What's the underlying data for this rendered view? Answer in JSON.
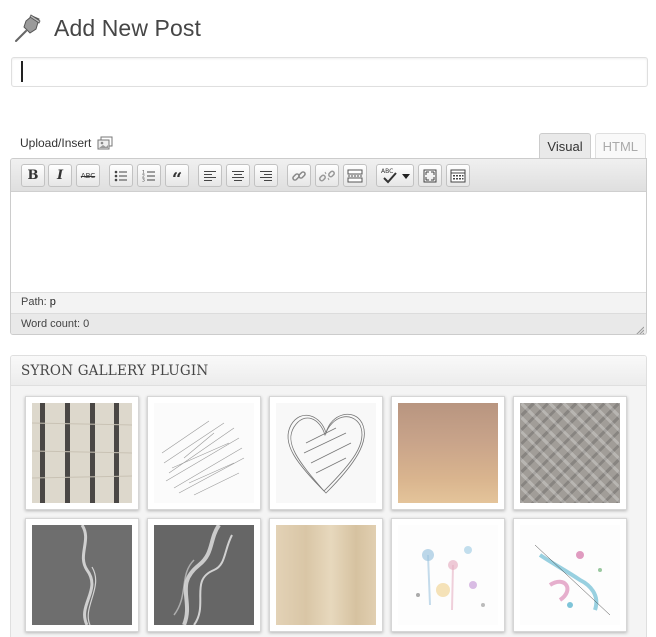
{
  "header": {
    "title": "Add New Post",
    "icon": "pin-icon"
  },
  "title_input": {
    "value": "",
    "placeholder": ""
  },
  "upload": {
    "label": "Upload/Insert",
    "icon": "media-icon"
  },
  "tabs": [
    {
      "label": "Visual",
      "active": true
    },
    {
      "label": "HTML",
      "active": false
    }
  ],
  "toolbar": {
    "buttons": [
      {
        "name": "bold",
        "icon": "bold-icon",
        "glyph": "B"
      },
      {
        "name": "italic",
        "icon": "italic-icon",
        "glyph": "I"
      },
      {
        "name": "strikethrough",
        "icon": "strikethrough-icon",
        "glyph": "ABC"
      },
      {
        "name": "bullet-list",
        "icon": "bullet-list-icon"
      },
      {
        "name": "numbered-list",
        "icon": "numbered-list-icon"
      },
      {
        "name": "blockquote",
        "icon": "blockquote-icon",
        "glyph": "“"
      },
      {
        "name": "align-left",
        "icon": "align-left-icon"
      },
      {
        "name": "align-center",
        "icon": "align-center-icon"
      },
      {
        "name": "align-right",
        "icon": "align-right-icon"
      },
      {
        "name": "insert-link",
        "icon": "link-icon"
      },
      {
        "name": "remove-link",
        "icon": "unlink-icon"
      },
      {
        "name": "insert-more",
        "icon": "more-tag-icon"
      },
      {
        "name": "spellcheck",
        "icon": "spellcheck-icon",
        "glyph": "ABC"
      },
      {
        "name": "fullscreen",
        "icon": "fullscreen-icon"
      },
      {
        "name": "kitchen-sink",
        "icon": "kitchen-sink-icon"
      }
    ]
  },
  "status": {
    "path_label": "Path:",
    "path_value": "p",
    "word_count": "Word count: 0"
  },
  "gallery": {
    "title": "SYRON GALLERY PLUGIN",
    "thumbnails": [
      {
        "name": "wood-bars"
      },
      {
        "name": "pencil-scribble"
      },
      {
        "name": "sketched-heart"
      },
      {
        "name": "copper-texture"
      },
      {
        "name": "diamond-plate"
      },
      {
        "name": "smoke-wisp"
      },
      {
        "name": "smoke-swirl"
      },
      {
        "name": "plywood"
      },
      {
        "name": "paint-splatter"
      },
      {
        "name": "ink-splatter"
      }
    ]
  }
}
